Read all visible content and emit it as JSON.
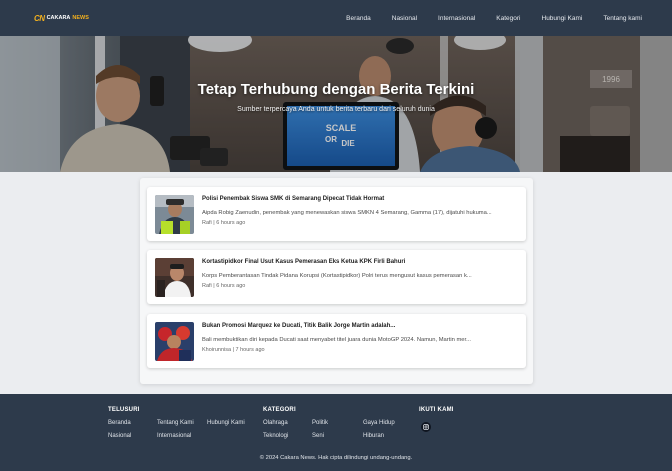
{
  "brand": {
    "mark": "CN",
    "word1": "CAKARA",
    "word2": "NEWS"
  },
  "nav": [
    {
      "label": "Beranda"
    },
    {
      "label": "Nasional"
    },
    {
      "label": "Internasional"
    },
    {
      "label": "Kategori"
    },
    {
      "label": "Hubungi Kami"
    },
    {
      "label": "Tentang kami"
    }
  ],
  "hero": {
    "title": "Tetap Terhubung dengan Berita Terkini",
    "subtitle": "Sumber terpercaya Anda untuk berita terbaru dari seluruh dunia",
    "monitor_text_1": "SCALE",
    "monitor_text_2": "OR",
    "monitor_text_3": "DIE",
    "sign_text": "1996"
  },
  "articles": [
    {
      "title": "Polisi Penembak Siswa SMK di Semarang Dipecat Tidak Hormat",
      "excerpt": "Aipda Robig Zaenudin, penembak yang menewaskan siswa SMKN 4 Semarang, Gamma (17), dijatuhi hukuma...",
      "meta": "Rafi | 6 hours ago"
    },
    {
      "title": "Kortastipidkor Final Usut Kasus Pemerasan Eks Ketua KPK Firli Bahuri",
      "excerpt": "Korps Pemberantasan Tindak Pidana Korupsi (Kortastipidkor) Polri terus mengusut kasus pemerasan k...",
      "meta": "Rafi | 6 hours ago"
    },
    {
      "title": "Bukan Promosi Marquez ke Ducati, Titik Balik Jorge Martin adalah...",
      "excerpt": "Bali membuktikan diri kepada Ducati saat menyabet titel juara dunia MotoGP 2024. Namun, Martin mer...",
      "meta": "Khoirunnisa | 7 hours ago"
    }
  ],
  "footer": {
    "telusuri": {
      "heading": "TELUSURI",
      "links": [
        "Beranda",
        "Tentang Kami",
        "Hubungi Kami",
        "Nasional",
        "Internasional"
      ]
    },
    "kategori": {
      "heading": "KATEGORI",
      "links": [
        "Olahraga",
        "Politik",
        "Gaya Hidup",
        "Teknologi",
        "Seni",
        "Hiburan"
      ]
    },
    "ikuti": {
      "heading": "IKUTI KAMI",
      "icon": "instagram-icon"
    },
    "copyright": "© 2024 Cakara News. Hak cipta dilindungi undang-undang."
  },
  "colors": {
    "nav_bg": "#2d3a4b",
    "accent": "#f2b01e",
    "page_bg": "#ebedf0"
  }
}
